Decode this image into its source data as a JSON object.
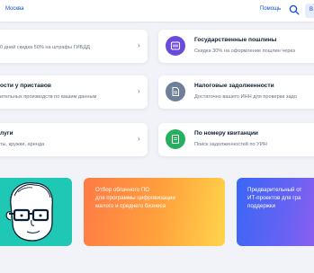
{
  "header": {
    "city": "Москва",
    "help_label": "Помощь",
    "search_icon": "search-icon",
    "login_letter": "В"
  },
  "cards": {
    "fines": {
      "subtitle": "0 дней скидка 50% на штрафы ГИБДД"
    },
    "fees": {
      "title": "Государственные пошлины",
      "subtitle": "Скидка 30% на оформление пошлин через",
      "icon": "duty-icon"
    },
    "bailiffs": {
      "title": "ости у приставов",
      "subtitle": "ительных производств по вашим данным"
    },
    "tax": {
      "title": "Налоговые задолженности",
      "subtitle": "Достаточно вашего ИНН для проверки задо",
      "icon": "tax-document-icon"
    },
    "services": {
      "title": "луги",
      "subtitle": "ты, кружки, аренда"
    },
    "receipt": {
      "title": "По номеру квитанции",
      "subtitle": "Поиск задолженностей по УИН",
      "icon": "receipt-icon"
    }
  },
  "promos": {
    "software": {
      "line1": "Отбор облачного ПО",
      "line2": "для программы цифровизации",
      "line3": "малого и среднего бизнеса"
    },
    "it": {
      "line1": "Предварительный от",
      "line2": "ИТ-проектов для гра",
      "line3": "поддержки"
    }
  },
  "colors": {
    "accent": "#0d4cd3",
    "fees_icon_bg": "#6b4bd8",
    "tax_icon_bg": "#6e7f99",
    "receipt_icon_bg": "#27ae60",
    "promo_teal": "#1ec8b4",
    "promo_orange_start": "#ff8a3d",
    "promo_orange_end": "#ffd14a",
    "promo_blue_start": "#3b6cf5",
    "promo_blue_end": "#9c5cf0"
  }
}
